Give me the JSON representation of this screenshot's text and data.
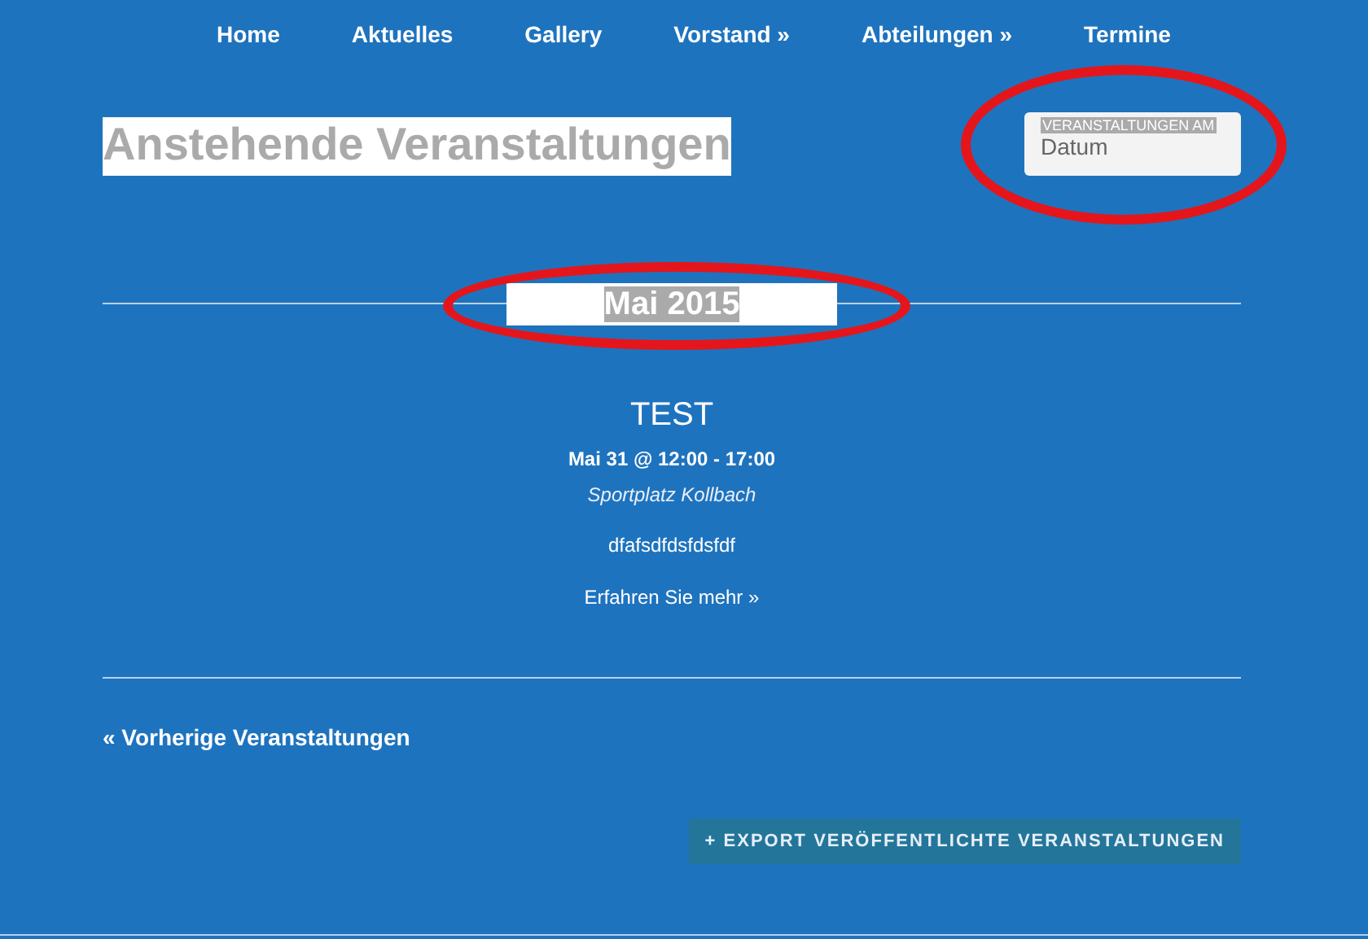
{
  "nav": {
    "items": [
      {
        "label": "Home"
      },
      {
        "label": "Aktuelles"
      },
      {
        "label": "Gallery"
      },
      {
        "label": "Vorstand »"
      },
      {
        "label": "Abteilungen »"
      },
      {
        "label": "Termine"
      }
    ]
  },
  "page_title": "Anstehende Veranstaltungen",
  "date_filter": {
    "label": "VERANSTALTUNGEN AM",
    "placeholder": "Datum"
  },
  "month_heading": "Mai 2015",
  "events": [
    {
      "title": "TEST",
      "when": "Mai 31 @ 12:00 - 17:00",
      "venue": "Sportplatz Kollbach",
      "description": "dfafsdfdsfdsfdf",
      "more_link": "Erfahren Sie mehr »"
    }
  ],
  "previous_link": "« Vorherige Veranstaltungen",
  "export_button": "+ EXPORT VERÖFFENTLICHTE VERANSTALTUNGEN"
}
